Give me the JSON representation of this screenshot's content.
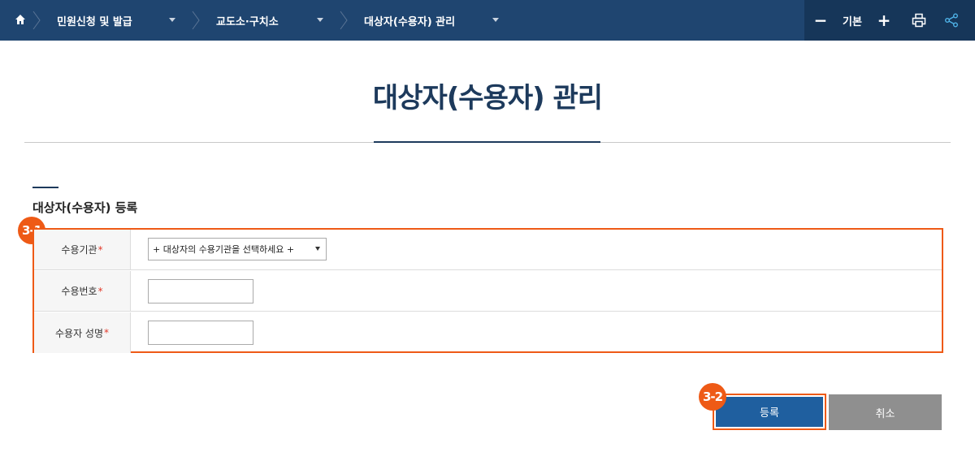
{
  "nav": {
    "breadcrumbs": [
      {
        "label": "민원신청 및 발급"
      },
      {
        "label": "교도소·구치소"
      },
      {
        "label": "대상자(수용자) 관리"
      }
    ],
    "tools": {
      "minus": "−",
      "zoom_label": "기본",
      "plus": "+"
    }
  },
  "page": {
    "title": "대상자(수용자) 관리"
  },
  "section": {
    "title": "대상자(수용자) 등록"
  },
  "form": {
    "badge": "3-1",
    "rows": [
      {
        "label": "수용기관",
        "required_mark": "*",
        "select_value": "+ 대상자의 수용기관을 선택하세요 +"
      },
      {
        "label": "수용번호",
        "required_mark": "*",
        "value": ""
      },
      {
        "label": "수용자 성명",
        "required_mark": "*",
        "value": ""
      }
    ]
  },
  "actions": {
    "badge": "3-2",
    "register_label": "등록",
    "cancel_label": "취소"
  },
  "colors": {
    "nav_bg": "#1f4570",
    "title": "#1d3a5c",
    "highlight": "#ee5a16",
    "primary_button": "#1f5f9f",
    "secondary_button": "#8f8f8f"
  }
}
